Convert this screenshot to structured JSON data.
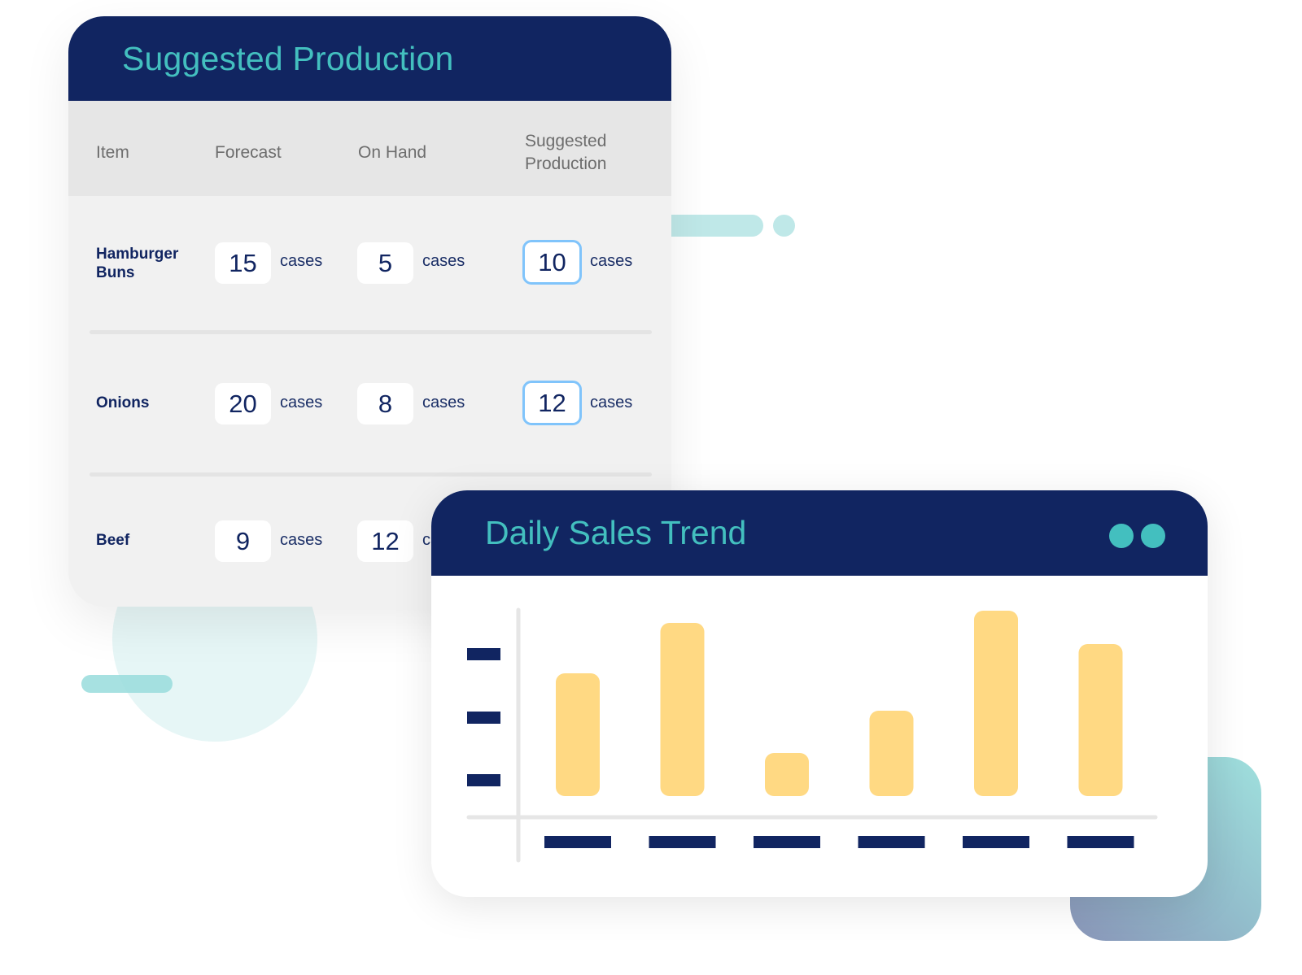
{
  "suggested_production": {
    "title": "Suggested Production",
    "columns": [
      "Item",
      "Forecast",
      "On Hand",
      "Suggested Production"
    ],
    "column_suggested_lines": [
      "Suggested",
      "Production"
    ],
    "rows": [
      {
        "item_lines": [
          "Hamburger",
          "Buns"
        ],
        "forecast": "15",
        "forecast_unit": "cases",
        "on_hand": "5",
        "on_hand_unit": "cases",
        "suggested": "10",
        "suggested_unit": "cases"
      },
      {
        "item_lines": [
          "Onions"
        ],
        "forecast": "20",
        "forecast_unit": "cases",
        "on_hand": "8",
        "on_hand_unit": "cases",
        "suggested": "12",
        "suggested_unit": "cases"
      },
      {
        "item_lines": [
          "Beef"
        ],
        "forecast": "9",
        "forecast_unit": "cases",
        "on_hand": "12",
        "on_hand_unit": "cases"
      }
    ]
  },
  "daily_sales": {
    "title": "Daily Sales Trend",
    "window_controls": [
      "dot-icon",
      "dot-icon"
    ]
  },
  "colors": {
    "navy": "#112561",
    "teal": "#43bfbf",
    "bar": "#ffd983",
    "highlight_border": "#80c4fb",
    "panel_bg": "#f1f1f1",
    "thead_bg": "#e6e6e6"
  },
  "chart_data": {
    "type": "bar",
    "title": "Daily Sales Trend",
    "categories": [
      "",
      "",
      "",
      "",
      "",
      ""
    ],
    "values": [
      151,
      213,
      53,
      105,
      228,
      187
    ],
    "ytick_labels": [
      "",
      "",
      ""
    ],
    "xlabel": "",
    "ylabel": "",
    "ylim": [
      0,
      250
    ],
    "grid": false,
    "legend": "none",
    "note": "Tick labels are rendered as placeholder bars (no text); values are relative magnitudes"
  }
}
